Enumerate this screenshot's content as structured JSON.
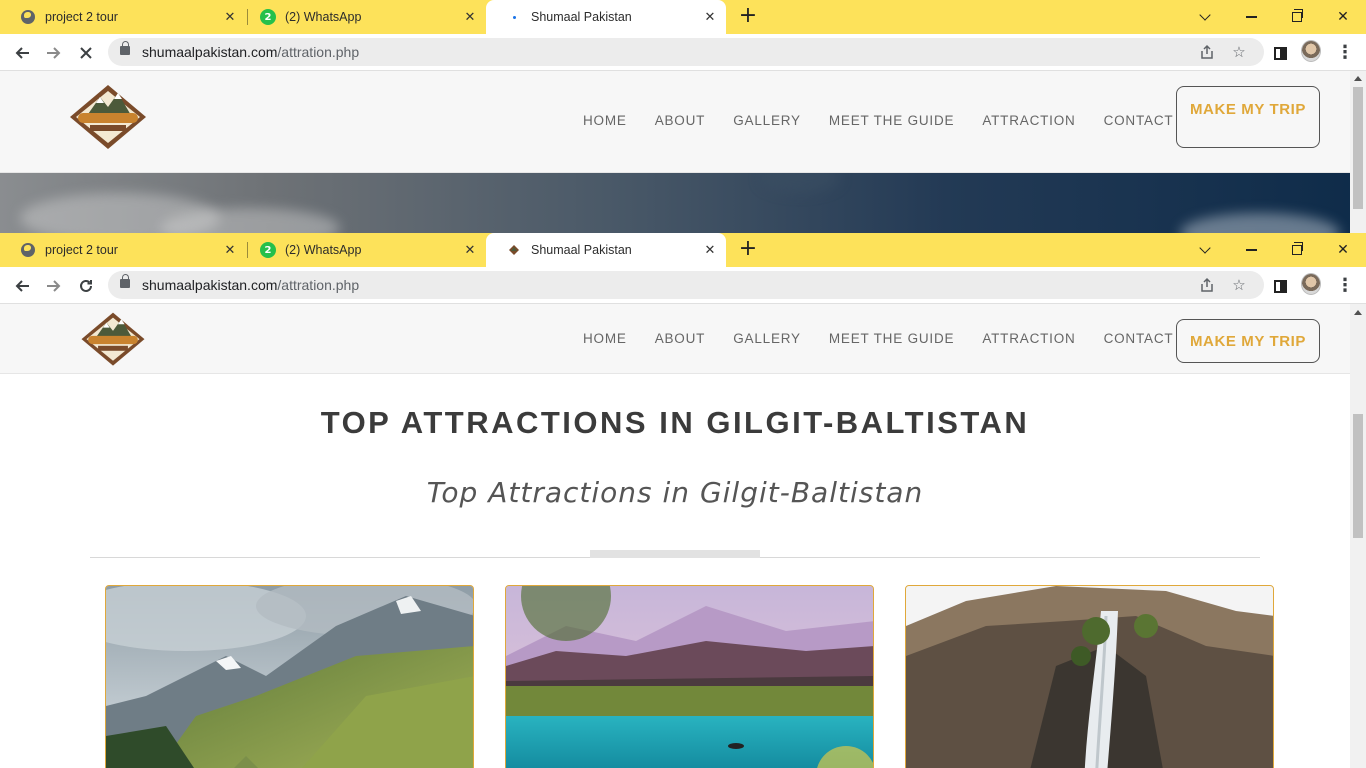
{
  "browser": {
    "tabs": [
      {
        "title": "project 2 tour"
      },
      {
        "title": "(2) WhatsApp",
        "badge": "2"
      },
      {
        "title": "Shumaal Pakistan"
      }
    ],
    "url_host": "shumaalpakistan.com",
    "url_path": "/attration.php",
    "new_tab_symbol": "+",
    "close_symbol": "✕"
  },
  "site": {
    "nav": [
      "HOME",
      "ABOUT",
      "GALLERY",
      "MEET THE GUIDE",
      "ATTRACTION",
      "CONTACT"
    ],
    "cta": "MAKE MY TRIP",
    "logo_text": "Shumaal Pakistan",
    "heading": "TOP ATTRACTIONS IN GILGIT-BALTISTAN",
    "subheading": "Top Attractions in Gilgit-Baltistan"
  },
  "colors": {
    "tabstrip": "#fde25a",
    "accent": "#e0a83a",
    "heading": "#3b3b3b"
  },
  "icons": [
    "globe-icon",
    "whatsapp-icon",
    "close-icon",
    "plus-icon",
    "back-icon",
    "forward-icon",
    "stop-icon",
    "reload-icon",
    "lock-icon",
    "share-icon",
    "star-icon",
    "side-panel-icon",
    "profile-avatar",
    "kebab-menu-icon",
    "chevron-down-icon",
    "minimize-icon",
    "restore-icon"
  ]
}
